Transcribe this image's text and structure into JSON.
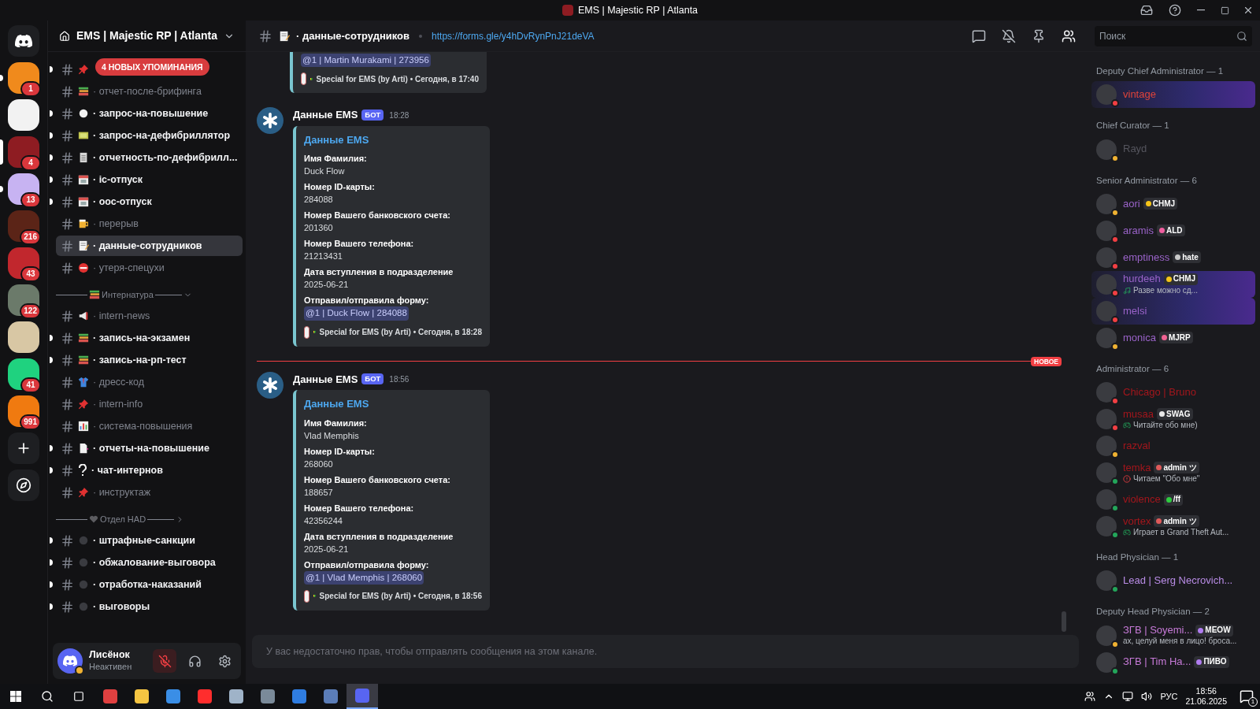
{
  "window": {
    "title": "EMS | Majestic RP | Atlanta"
  },
  "servers": [
    {
      "badge": "1",
      "color": "#f08a1c",
      "unread": true,
      "selected": false
    },
    {
      "color": "#f2f2f2",
      "unread": false,
      "selected": false
    },
    {
      "badge": "4",
      "color": "#8e1c22",
      "unread": false,
      "selected": true
    },
    {
      "badge": "13",
      "color": "#c7b3f2",
      "unread": true,
      "selected": false
    },
    {
      "badge": "216",
      "color": "#5b2417",
      "unread": false,
      "selected": false
    },
    {
      "badge": "43",
      "color": "#c1272d",
      "unread": false,
      "selected": false
    },
    {
      "badge": "122",
      "color": "#6b7a6a",
      "unread": false,
      "selected": false
    },
    {
      "color": "#d8c7a4",
      "unread": false,
      "selected": false
    },
    {
      "badge": "41",
      "color": "#1fd27f",
      "unread": false,
      "selected": false
    },
    {
      "badge": "991",
      "color": "#f07a10",
      "unread": false,
      "selected": false
    }
  ],
  "guild": {
    "name": "EMS | Majestic RP | Atlanta",
    "mentions_pill": "4 НОВЫХ УПОМИНАНИЯ"
  },
  "channel_groups": [
    {
      "channels": [
        {
          "kind": "pin",
          "unread": true,
          "selected": false
        },
        {
          "name": "· отчет-после-брифинга",
          "kind": "books",
          "unread": false,
          "selected": false
        },
        {
          "name": "· запрос-на-повышение",
          "kind": "circle",
          "unread": true,
          "selected": false
        },
        {
          "name": "· запрос-на-дефибриллятор",
          "kind": "screen",
          "unread": true,
          "selected": false
        },
        {
          "name": "· отчетность-по-дефибрилл...",
          "kind": "clipboard",
          "unread": true,
          "selected": false
        },
        {
          "name": "· ic-отпуск",
          "kind": "calendar",
          "unread": true,
          "selected": false
        },
        {
          "name": "· оос-отпуск",
          "kind": "calendar",
          "unread": true,
          "selected": false
        },
        {
          "name": "· перерыв",
          "kind": "beer",
          "unread": false,
          "selected": false
        },
        {
          "name": "· данные-сотрудников",
          "kind": "memo",
          "unread": false,
          "selected": true
        },
        {
          "name": "· утеря-спецухи",
          "kind": "noentry",
          "unread": false,
          "selected": false
        }
      ]
    },
    {
      "category": {
        "name": "Интернатура",
        "expanded": true,
        "kind": "books"
      },
      "channels": [
        {
          "name": "· intern-news",
          "kind": "megaphone",
          "unread": false,
          "selected": false
        },
        {
          "name": "· запись-на-экзамен",
          "kind": "books",
          "unread": true,
          "selected": false
        },
        {
          "name": "· запись-на-рп-тест",
          "kind": "books",
          "unread": true,
          "selected": false
        },
        {
          "name": "· дресс-код",
          "kind": "shirt",
          "unread": false,
          "selected": false
        },
        {
          "name": "· intern-info",
          "kind": "pin",
          "unread": false,
          "selected": false
        },
        {
          "name": "· система-повышения",
          "kind": "chart",
          "unread": false,
          "selected": false
        },
        {
          "name": "· отчеты-на-повышение",
          "kind": "page",
          "unread": true,
          "selected": false
        },
        {
          "name": "· чат-интернов",
          "kind": "question",
          "unread": true,
          "selected": false
        },
        {
          "name": "· инструктаж",
          "kind": "pin",
          "unread": false,
          "selected": false
        }
      ]
    },
    {
      "category": {
        "name": "Отдел HAD",
        "expanded": false,
        "kind": "heart"
      },
      "channels": [
        {
          "name": "· штрафные-санкции",
          "kind": "dot",
          "unread": true,
          "selected": false
        },
        {
          "name": "· обжалование-выговора",
          "kind": "dot",
          "unread": true,
          "selected": false
        },
        {
          "name": "· отработка-наказаний",
          "kind": "dot",
          "unread": true,
          "selected": false
        },
        {
          "name": "· выговоры",
          "kind": "dot",
          "unread": true,
          "selected": false
        }
      ]
    }
  ],
  "user_panel": {
    "name": "Лисёнок",
    "status": "Неактивен",
    "muted": true
  },
  "header": {
    "channel": "· данные-сотрудников",
    "topic": "https://forms.gle/y4hDvRynPnJ21deVA",
    "search": {
      "placeholder": "Поиск"
    }
  },
  "messages": [
    {
      "kind": "embed_tail",
      "mention": "@1 | Martin Murakami | 273956",
      "footer": "Special for EMS (by Arti) • Сегодня, в 17:40"
    },
    {
      "kind": "message",
      "author": "Данные EMS",
      "tag": "БОТ",
      "time": "18:28",
      "embed": {
        "title": "Данные EMS",
        "fields": [
          {
            "name": "Имя Фамилия:",
            "value": "Duck Flow"
          },
          {
            "name": "Номер ID-карты:",
            "value": "284088"
          },
          {
            "name": "Номер Вашего банковского счета:",
            "value": "201360"
          },
          {
            "name": "Номер Вашего телефона:",
            "value": "21213431"
          },
          {
            "name": "Дата вступления в подразделение",
            "value": "2025-06-21"
          }
        ],
        "sender_label": "Отправил/отправила форму:",
        "mention": "@1 | Duck Flow | 284088",
        "footer": "Special for EMS (by Arti) • Сегодня, в 18:28"
      }
    },
    {
      "kind": "divider",
      "label": "НОВОЕ"
    },
    {
      "kind": "message",
      "author": "Данные EMS",
      "tag": "БОТ",
      "time": "18:56",
      "embed": {
        "title": "Данные EMS",
        "fields": [
          {
            "name": "Имя Фамилия:",
            "value": "Vlad Memphis"
          },
          {
            "name": "Номер ID-карты:",
            "value": "268060"
          },
          {
            "name": "Номер Вашего банковского счета:",
            "value": "188657"
          },
          {
            "name": "Номер Вашего телефона:",
            "value": "42356244"
          },
          {
            "name": "Дата вступления в подразделение",
            "value": "2025-06-21"
          }
        ],
        "sender_label": "Отправил/отправила форму:",
        "mention": "@1 | Vlad Memphis | 268060",
        "footer": "Special for EMS (by Arti) • Сегодня, в 18:56"
      }
    }
  ],
  "composer": {
    "notice": "У вас недостаточно прав, чтобы отправлять сообщения на этом канале."
  },
  "member_groups": [
    {
      "title": "Deputy Chief Administrator — 1",
      "members": [
        {
          "name": "vintage",
          "color": "#e0443a",
          "presence": {
            "color": "#f23f43"
          },
          "banner": true
        }
      ]
    },
    {
      "title": "Chief Curator — 1",
      "members": [
        {
          "name": "Rayd",
          "color": "#55555e",
          "presence": {
            "color": "#f0b232"
          },
          "banner": false
        }
      ]
    },
    {
      "title": "Senior Administrator — 6",
      "members": [
        {
          "name": "aori",
          "color": "#9a63c9",
          "presence": {
            "color": "#f0b232"
          },
          "banner": false,
          "tag": {
            "label": "CHMJ",
            "color": "#f5c518"
          }
        },
        {
          "name": "aramis",
          "color": "#9a63c9",
          "presence": {
            "color": "#f23f43"
          },
          "banner": false,
          "tag": {
            "label": "ALD",
            "color": "#f05fa0"
          }
        },
        {
          "name": "emptiness",
          "color": "#9a63c9",
          "presence": {
            "color": "#f23f43"
          },
          "banner": false,
          "tag": {
            "label": "hate",
            "color": "#c9c9c9"
          }
        },
        {
          "name": "hurdeeh",
          "color": "#9a63c9",
          "presence": {
            "color": "#f23f43"
          },
          "banner": true,
          "tag": {
            "label": "CHMJ",
            "color": "#f5c518"
          },
          "activity": {
            "kind": "music",
            "text": "Разве можно сд..."
          }
        },
        {
          "name": "melsi",
          "color": "#9a63c9",
          "presence": {
            "color": "#f23f43"
          },
          "banner": true
        },
        {
          "name": "monica",
          "color": "#9a63c9",
          "presence": {
            "color": "#f0b232"
          },
          "banner": false,
          "tag": {
            "label": "MJRP",
            "color": "#f06292"
          }
        }
      ]
    },
    {
      "title": "Administrator — 6",
      "members": [
        {
          "name": "Chicago | Bruno",
          "color": "#a3161c",
          "presence": {
            "color": "#f23f43"
          },
          "banner": false
        },
        {
          "name": "musaa",
          "color": "#a3161c",
          "presence": {
            "color": "#f23f43"
          },
          "banner": false,
          "tag": {
            "label": "SWAG",
            "color": "#e8e8e8"
          },
          "activity": {
            "kind": "game",
            "text": "Читайте обо мне)"
          }
        },
        {
          "name": "razval",
          "color": "#a3161c",
          "presence": {
            "color": "#f0b232"
          },
          "banner": false
        },
        {
          "name": "temka",
          "color": "#a3161c",
          "presence": {
            "color": "#23a55a"
          },
          "banner": false,
          "tag": {
            "label": "admin ツ",
            "color": "#e05a5a"
          },
          "activity": {
            "kind": "alert",
            "text": "Читаем \"Обо мне\""
          }
        },
        {
          "name": "violence",
          "color": "#a3161c",
          "presence": {
            "color": "#23a55a"
          },
          "banner": false,
          "tag": {
            "label": "/ff",
            "color": "#2ecc40"
          }
        },
        {
          "name": "vortex",
          "color": "#a3161c",
          "presence": {
            "color": "#23a55a"
          },
          "banner": false,
          "tag": {
            "label": "admin ツ",
            "color": "#e05a5a"
          },
          "activity": {
            "kind": "game",
            "text": "Играет в Grand Theft Aut..."
          }
        }
      ]
    },
    {
      "title": "Head Physician — 1",
      "members": [
        {
          "name": "Lead | Serg Necrovich...",
          "color": "#b98ce6",
          "presence": {
            "color": "#23a55a"
          },
          "banner": false
        }
      ]
    },
    {
      "title": "Deputy Head Physician — 2",
      "members": [
        {
          "name": "ЗГВ | Soyemi...",
          "color": "#c77ad8",
          "presence": {
            "color": "#f0b232"
          },
          "banner": false,
          "tag": {
            "label": "MEOW",
            "color": "#b07cf0"
          },
          "activity": {
            "kind": "text",
            "text": "ах, целуй меня в лицо! броса..."
          }
        },
        {
          "name": "ЗГВ | Tim Ha...",
          "color": "#c77ad8",
          "presence": {
            "color": "#23a55a"
          },
          "banner": false,
          "tag": {
            "label": "ПИВО",
            "color": "#b07cf0"
          }
        }
      ]
    }
  ],
  "taskbar": {
    "apps": [
      {
        "color": "#e04040",
        "active": false
      },
      {
        "color": "#f5c542",
        "active": false
      },
      {
        "color": "#3a8ee6",
        "active": false
      },
      {
        "color": "#ff2d2d",
        "active": false
      },
      {
        "color": "#9fb3c8",
        "active": false
      },
      {
        "color": "#7a8a99",
        "active": false
      },
      {
        "color": "#2f7de1",
        "active": false
      },
      {
        "color": "#5b7db8",
        "active": false
      },
      {
        "color": "#5865f2",
        "active": true
      }
    ],
    "language": "РУС",
    "time": "18:56",
    "date": "21.06.2025",
    "notifications": "1"
  }
}
